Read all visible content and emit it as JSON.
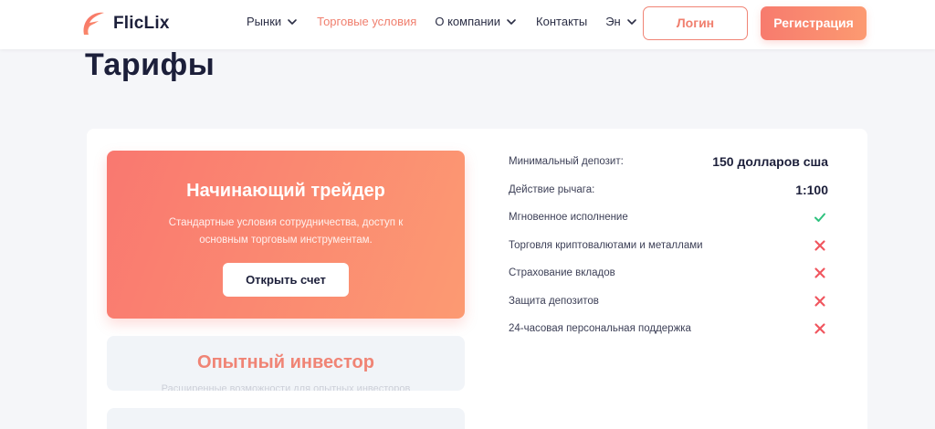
{
  "brand": {
    "name": "FlicLix",
    "logo_icon": "flame-f-icon",
    "accent": "#f77b6e"
  },
  "nav": {
    "items": [
      {
        "label": "Рынки",
        "dropdown": true,
        "active": false
      },
      {
        "label": "Торговые условия",
        "dropdown": false,
        "active": true
      },
      {
        "label": "О компании",
        "dropdown": true,
        "active": false
      },
      {
        "label": "Контакты",
        "dropdown": false,
        "active": false
      },
      {
        "label": "Эн",
        "dropdown": true,
        "active": false
      }
    ]
  },
  "auth": {
    "login_label": "Логин",
    "register_label": "Регистрация"
  },
  "page": {
    "title": "Тарифы"
  },
  "plans": [
    {
      "title": "Начинающий трейдер",
      "description": "Стандартные условия сотрудничества, доступ к основным торговым инструментам.",
      "button_label": "Открыть счет"
    },
    {
      "title": "Опытный инвестор",
      "description": "Расширенные возможности для опытных инвесторов"
    }
  ],
  "features": [
    {
      "label": "Минимальный депозит:",
      "value": "150 долларов сша",
      "type": "text"
    },
    {
      "label": "Действие рычага:",
      "value": "1:100",
      "type": "text"
    },
    {
      "label": "Мгновенное исполнение",
      "type": "check",
      "icon": "check-icon"
    },
    {
      "label": "Торговля криптовалютами и металлами",
      "type": "cross",
      "icon": "cross-icon"
    },
    {
      "label": "Страхование вкладов",
      "type": "cross",
      "icon": "cross-icon"
    },
    {
      "label": "Защита депозитов",
      "type": "cross",
      "icon": "cross-icon"
    },
    {
      "label": "24-часовая персональная поддержка",
      "type": "cross",
      "icon": "cross-icon"
    }
  ],
  "colors": {
    "check": "#2ec27e",
    "cross": "#f0565f"
  }
}
